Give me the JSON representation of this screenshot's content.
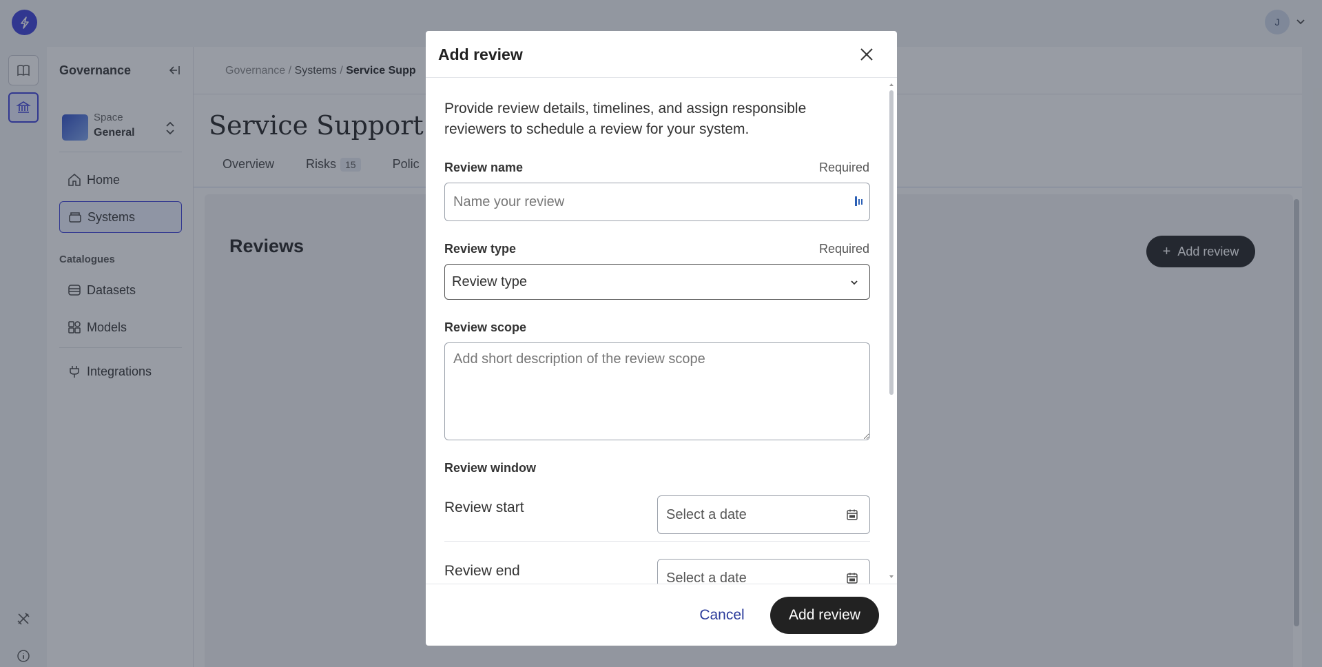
{
  "app": {
    "user_initial": "J"
  },
  "sidebar": {
    "title": "Governance",
    "space_label": "Space",
    "space_name": "General",
    "nav": [
      {
        "label": "Home"
      },
      {
        "label": "Systems"
      }
    ],
    "catalogues_heading": "Catalogues",
    "catalogues": [
      {
        "label": "Datasets"
      },
      {
        "label": "Models"
      }
    ],
    "integrations_label": "Integrations"
  },
  "main": {
    "breadcrumb": [
      "Governance",
      "Systems",
      "Service Supp"
    ],
    "breadcrumb_sep": "/",
    "page_title": "Service Support Ch",
    "tabs": [
      {
        "label": "Overview"
      },
      {
        "label": "Risks",
        "badge": "15"
      },
      {
        "label": "Polic"
      }
    ],
    "reviews_title": "Reviews",
    "add_review_button": "Add review"
  },
  "modal": {
    "title": "Add review",
    "intro": "Provide review details, timelines, and assign responsible reviewers to schedule a review for your system.",
    "review_name": {
      "label": "Review name",
      "required": "Required",
      "placeholder": "Name your review"
    },
    "review_type": {
      "label": "Review type",
      "required": "Required",
      "value": "Review type"
    },
    "review_scope": {
      "label": "Review scope",
      "placeholder": "Add short description of the review scope"
    },
    "review_window": {
      "label": "Review window",
      "start_label": "Review start",
      "start_placeholder": "Select a date",
      "end_label": "Review end",
      "end_placeholder": "Select a date"
    },
    "cancel_button": "Cancel",
    "submit_button": "Add review"
  }
}
